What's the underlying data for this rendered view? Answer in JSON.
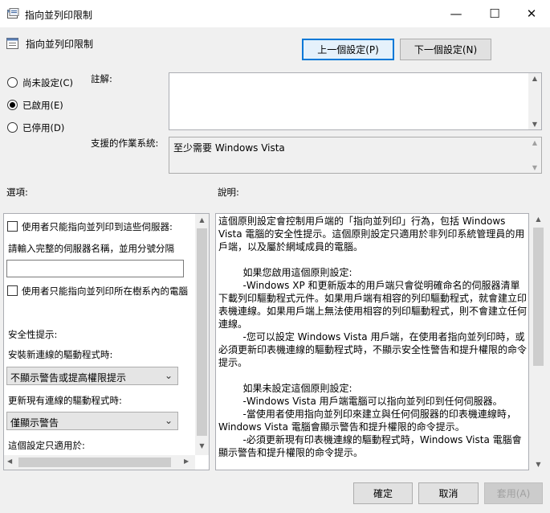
{
  "window": {
    "title": "指向並列印限制",
    "controls": {
      "minimize": "—",
      "maximize": "☐",
      "close": "✕"
    }
  },
  "header": {
    "policy_name": "指向並列印限制",
    "prev_button": "上一個設定(P)",
    "next_button": "下一個設定(N)"
  },
  "state": {
    "options": [
      {
        "label": "尚未設定(C)",
        "selected": false
      },
      {
        "label": "已啟用(E)",
        "selected": true
      },
      {
        "label": "已停用(D)",
        "selected": false
      }
    ]
  },
  "comment": {
    "label": "註解:",
    "value": ""
  },
  "supported": {
    "label": "支援的作業系統:",
    "value": "至少需要 Windows Vista"
  },
  "options_pane": {
    "heading": "選項:",
    "checkbox1": {
      "label": "使用者只能指向並列印到這些伺服器:",
      "checked": false
    },
    "servers_label": "請輸入完整的伺服器名稱，並用分號分隔",
    "servers_value": "",
    "checkbox2": {
      "label": "使用者只能指向並列印所在樹系內的電腦",
      "checked": false
    },
    "security_heading": "安全性提示:",
    "install_label": "安裝新連線的驅動程式時:",
    "install_value": "不顯示警告或提高權限提示",
    "update_label": "更新現有連線的驅動程式時:",
    "update_value": "僅顯示警告",
    "applies_label": "這個設定只適用於:"
  },
  "help_pane": {
    "heading": "說明:",
    "text": "這個原則設定會控制用戶端的「指向並列印」行為，包括 Windows Vista 電腦的安全性提示。這個原則設定只適用於非列印系統管理員的用戶端，以及屬於網域成員的電腦。\n\n        如果您啟用這個原則設定:\n        -Windows XP 和更新版本的用戶端只會從明確命名的伺服器清單下載列印驅動程式元件。如果用戶端有相容的列印驅動程式，就會建立印表機連線。如果用戶端上無法使用相容的列印驅動程式，則不會建立任何連線。\n        -您可以設定 Windows Vista 用戶端，在使用者指向並列印時，或必須更新印表機連線的驅動程式時，不顯示安全性警告和提升權限的命令提示。\n\n        如果未設定這個原則設定:\n        -Windows Vista 用戶端電腦可以指向並列印到任何伺服器。\n        -當使用者使用指向並列印來建立與任何伺服器的印表機連線時，Windows Vista 電腦會顯示警告和提升權限的命令提示。\n        -必須更新現有印表機連線的驅動程式時，Windows Vista 電腦會顯示警告和提升權限的命令提示。"
  },
  "footer": {
    "ok": "確定",
    "cancel": "取消",
    "apply": "套用(A)"
  }
}
